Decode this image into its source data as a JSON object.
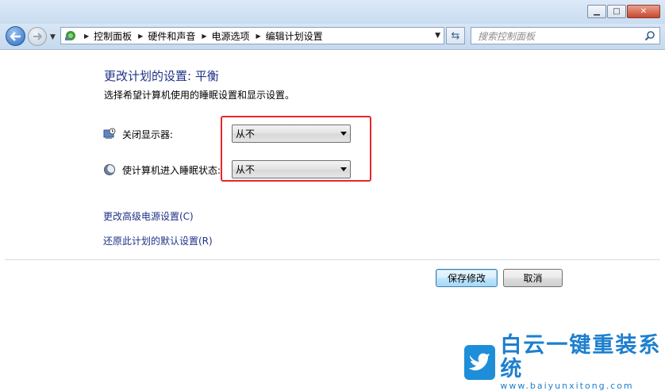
{
  "window": {
    "minimize_label": "▁",
    "maximize_label": "□",
    "close_label": "✕"
  },
  "nav": {
    "breadcrumbs": [
      "控制面板",
      "硬件和声音",
      "电源选项",
      "编辑计划设置"
    ],
    "search_placeholder": "搜索控制面板"
  },
  "content": {
    "title": "更改计划的设置: 平衡",
    "subtitle": "选择希望计算机使用的睡眠设置和显示设置。",
    "settings": [
      {
        "label": "关闭显示器:",
        "value": "从不",
        "icon": "monitor-clock-icon"
      },
      {
        "label": "使计算机进入睡眠状态:",
        "value": "从不",
        "icon": "moon-icon"
      }
    ],
    "links": [
      "更改高级电源设置(C)",
      "还原此计划的默认设置(R)"
    ]
  },
  "buttons": {
    "save": "保存修改",
    "cancel": "取消"
  },
  "watermark": {
    "title": "白云一键重装系统",
    "url": "www.baiyunxitong.com"
  },
  "colors": {
    "link": "#1e3287",
    "highlight": "#e8262a",
    "watermark": "#1c7fcf"
  }
}
